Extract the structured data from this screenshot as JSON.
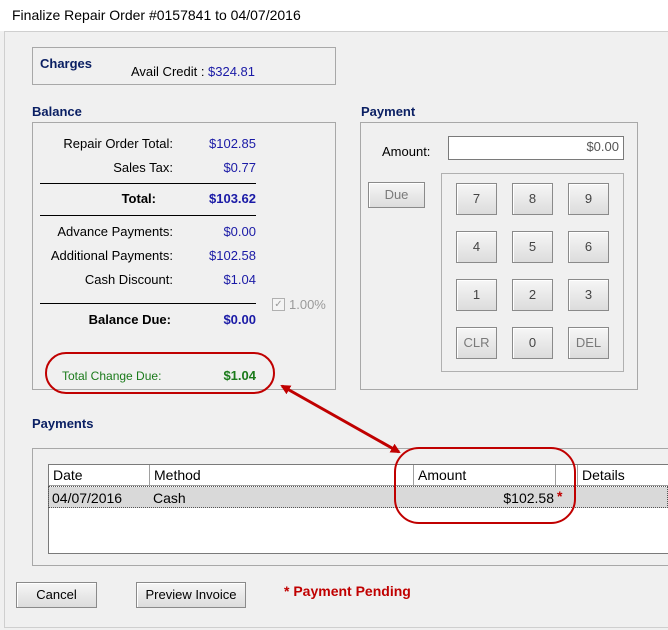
{
  "window": {
    "title": "Finalize Repair Order #0157841 to 04/07/2016"
  },
  "charges": {
    "header": "Charges",
    "avail_credit_label": "Avail Credit :",
    "avail_credit_value": "$324.81"
  },
  "balance": {
    "header": "Balance",
    "repair_order_total_label": "Repair Order Total:",
    "repair_order_total_value": "$102.85",
    "sales_tax_label": "Sales Tax:",
    "sales_tax_value": "$0.77",
    "total_label": "Total:",
    "total_value": "$103.62",
    "advance_payments_label": "Advance Payments:",
    "advance_payments_value": "$0.00",
    "additional_payments_label": "Additional Payments:",
    "additional_payments_value": "$102.58",
    "cash_discount_label": "Cash Discount:",
    "cash_discount_value": "$1.04",
    "discount_checkbox_label": "1.00%",
    "balance_due_label": "Balance Due:",
    "balance_due_value": "$0.00",
    "total_change_due_label": "Total Change Due:",
    "total_change_due_value": "$1.04"
  },
  "payment": {
    "header": "Payment",
    "amount_label": "Amount:",
    "amount_value": "$0.00",
    "due_label": "Due",
    "keypad": {
      "k7": "7",
      "k8": "8",
      "k9": "9",
      "k4": "4",
      "k5": "5",
      "k6": "6",
      "k1": "1",
      "k2": "2",
      "k3": "3",
      "clr": "CLR",
      "k0": "0",
      "del": "DEL"
    }
  },
  "payments": {
    "header": "Payments",
    "columns": {
      "date": "Date",
      "method": "Method",
      "amount": "Amount",
      "details": "Details"
    },
    "rows": [
      {
        "date": "04/07/2016",
        "method": "Cash",
        "amount": "$102.58",
        "pending_mark": "*"
      }
    ]
  },
  "footer": {
    "cancel_label": "Cancel",
    "preview_invoice_label": "Preview Invoice",
    "pending_note": "* Payment Pending"
  },
  "colors": {
    "accent_red": "#c00000",
    "value_blue": "#1a1aa6",
    "change_green": "#1a7a1a"
  }
}
